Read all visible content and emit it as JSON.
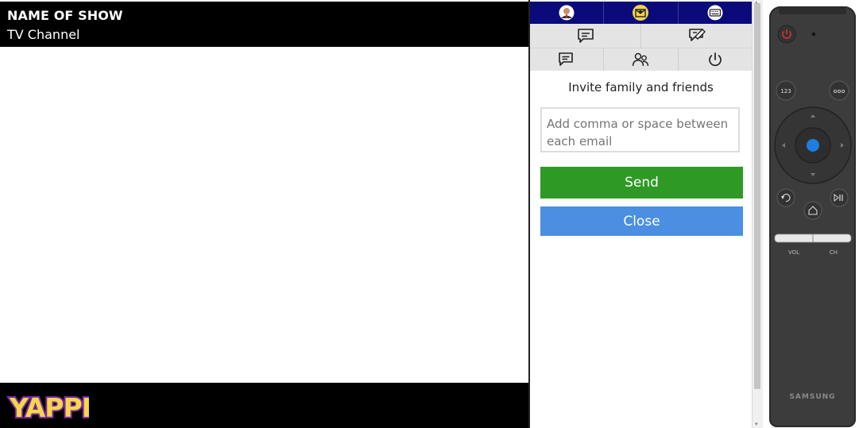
{
  "tv": {
    "show_name": "NAME OF SHOW",
    "channel_name": "TV Channel",
    "logo_text": "YAPPI"
  },
  "panel": {
    "toolbar_top": [
      "user-avatar-icon",
      "inbox-mail-icon",
      "keyboard-icon"
    ],
    "toolbar_row2": [
      "chat-icon",
      "edit-chat-icon"
    ],
    "toolbar_row3": [
      "messages-icon",
      "people-icon",
      "power-icon"
    ],
    "invite_title": "Invite family and friends",
    "email_placeholder": "Add comma or space between each email",
    "send_label": "Send",
    "close_label": "Close"
  },
  "remote": {
    "brand": "SAMSUNG",
    "btn_123": "123",
    "vol_label": "VOL",
    "ch_label": "CH"
  },
  "colors": {
    "toolbar_top_bg": "#0a0a7a",
    "send_bg": "#2e9a25",
    "close_bg": "#4a8fe2",
    "remote_bg": "#3c3c3c",
    "logo_yellow": "#f7d64a",
    "logo_purple": "#7a2ca0"
  }
}
